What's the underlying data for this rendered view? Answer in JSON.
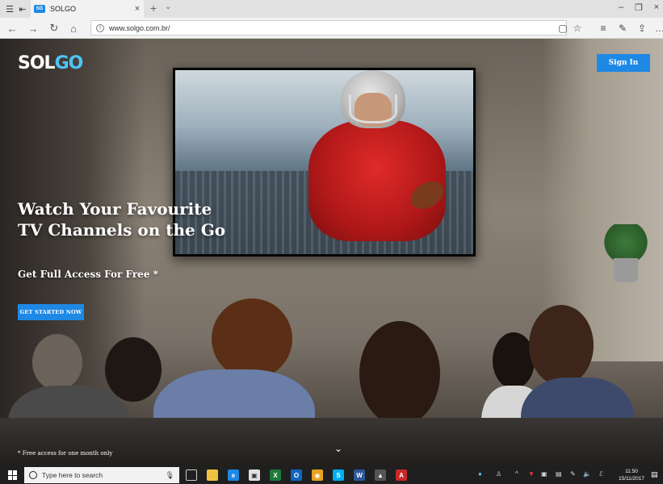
{
  "browser": {
    "tab_title": "SOLGO",
    "tab_favicon_text": "SG",
    "address": "www.solgo.com.br/",
    "icons": {
      "tab_manager": "tab-manager-icon",
      "back_tab": "back-tab-icon",
      "close": "close-icon",
      "new_tab": "plus-icon",
      "tab_list": "chevron-down-icon",
      "back": "back-arrow-icon",
      "forward": "forward-arrow-icon",
      "refresh": "refresh-icon",
      "home": "home-icon",
      "reading_view": "reading-view-icon",
      "favorite": "star-icon",
      "favorites_hub": "favorites-hub-icon",
      "notes": "pen-icon",
      "share": "share-icon",
      "more": "ellipsis-icon"
    }
  },
  "page": {
    "logo_prefix": "SOL",
    "logo_suffix": "GO",
    "sign_in": "Sign In",
    "hero_line1": "Watch Your Favourite",
    "hero_line2": "TV Channels on the Go",
    "subheading": "Get Full Access For Free *",
    "cta": "GET STARTED NOW",
    "footnote": "* Free access for one month only"
  },
  "taskbar": {
    "search_placeholder": "Type here to search",
    "time": "11:50",
    "date": "15/11/2017"
  },
  "colors": {
    "accent": "#1e88e5",
    "logo_accent": "#4fc3f7",
    "taskbar": "#1f1f1f"
  }
}
